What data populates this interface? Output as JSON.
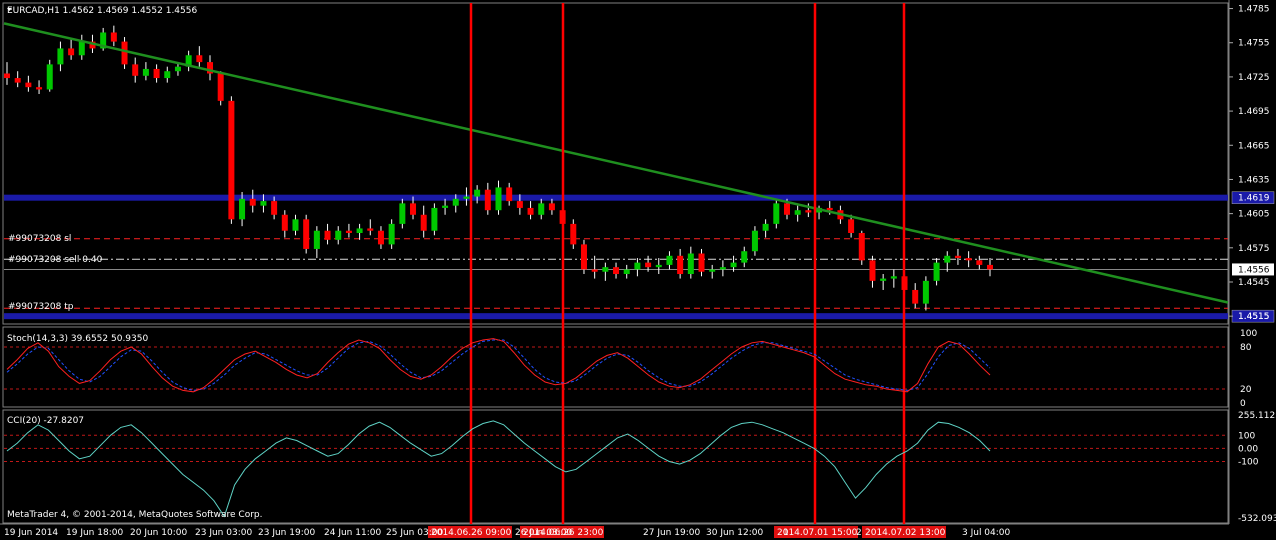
{
  "window": {
    "symbol_header": "EURCAD,H1  1.4562 1.4569 1.4552 1.4556",
    "copyright": "MetaTrader 4, © 2001-2014, MetaQuotes Software Corp."
  },
  "colors": {
    "background": "#000000",
    "bull_candle": "#00c800",
    "bear_candle": "#ff0000",
    "wick": "#ffffff",
    "trendline": "#1f8f1f",
    "support_line": "#1a1aa8",
    "vline": "#ff0000",
    "sl_line": "#ff2020",
    "tp_line": "#ff2020",
    "entry_line": "#dddddd",
    "stoch_main": "#ff2020",
    "stoch_signal": "#2050ff",
    "cci": "#5fd3c6",
    "indicator_level": "#c01818"
  },
  "main_panel": {
    "price_ticks": [
      "1.4785",
      "1.4755",
      "1.4725",
      "1.4695",
      "1.4665",
      "1.4635",
      "1.4605",
      "1.4575",
      "1.4545",
      "1.4515"
    ],
    "horizontal_level_tags": [
      {
        "name": "upper-support",
        "price": 1.4619,
        "tag": "1.4619"
      },
      {
        "name": "lower-support",
        "price": 1.4515,
        "tag": "1.4515"
      }
    ],
    "order_lines": {
      "sl_label": "#99073208 sl",
      "entry_label": "#99073208 sell 0.40",
      "tp_label": "#99073208 tp",
      "sl_price": 1.4583,
      "entry_price": 1.4565,
      "current_price": 1.4556,
      "current_price_tag": "1.4556",
      "tp_price": 1.4522
    }
  },
  "stoch_panel": {
    "label": "Stoch(14,3,3) 39.6552 50.9350",
    "ticks": [
      "100",
      "80",
      "20",
      "0"
    ],
    "levels": [
      80,
      20
    ]
  },
  "cci_panel": {
    "label": "CCI(20) -27.8207",
    "ticks": [
      "255.1125",
      "100",
      "0.00",
      "-100",
      "-532.093"
    ],
    "levels": [
      100,
      0,
      -100
    ]
  },
  "time_axis": {
    "labels": [
      "19 Jun 2014",
      "19 Jun 18:00",
      "20 Jun 10:00",
      "23 Jun 03:00",
      "23 Jun 19:00",
      "24 Jun 11:00",
      "25 Jun 03:00",
      "26 Jun 03:00",
      "27 Jun 19:00",
      "30 Jun 12:00",
      "1",
      "2",
      "3 Jul 04:00"
    ],
    "highlighted": [
      "2014.06.26 09:00",
      "2014.06.26 23:00",
      "2014.07.01 15:00",
      "2014.07.02 13:00"
    ]
  },
  "chart_data": {
    "type": "candlestick",
    "title": "EURCAD,H1",
    "ylim": [
      1.4509,
      1.4789
    ],
    "bars": [
      [
        1.4728,
        1.4738,
        1.4718,
        1.4724
      ],
      [
        1.4724,
        1.473,
        1.4716,
        1.472
      ],
      [
        1.472,
        1.4726,
        1.4712,
        1.4716
      ],
      [
        1.4716,
        1.4722,
        1.471,
        1.4714
      ],
      [
        1.4714,
        1.474,
        1.4712,
        1.4736
      ],
      [
        1.4736,
        1.4756,
        1.473,
        1.475
      ],
      [
        1.475,
        1.4758,
        1.474,
        1.4744
      ],
      [
        1.4744,
        1.4762,
        1.474,
        1.4756
      ],
      [
        1.4756,
        1.4762,
        1.4746,
        1.475
      ],
      [
        1.475,
        1.4768,
        1.4748,
        1.4764
      ],
      [
        1.4764,
        1.477,
        1.4752,
        1.4756
      ],
      [
        1.4756,
        1.476,
        1.4732,
        1.4736
      ],
      [
        1.4736,
        1.4742,
        1.472,
        1.4726
      ],
      [
        1.4726,
        1.4738,
        1.4722,
        1.4732
      ],
      [
        1.4732,
        1.4736,
        1.472,
        1.4724
      ],
      [
        1.4724,
        1.4734,
        1.472,
        1.473
      ],
      [
        1.473,
        1.4738,
        1.4726,
        1.4734
      ],
      [
        1.4734,
        1.4748,
        1.473,
        1.4744
      ],
      [
        1.4744,
        1.4752,
        1.4734,
        1.4738
      ],
      [
        1.4738,
        1.4744,
        1.4722,
        1.4728
      ],
      [
        1.4728,
        1.473,
        1.47,
        1.4704
      ],
      [
        1.4704,
        1.4708,
        1.4596,
        1.46
      ],
      [
        1.46,
        1.4624,
        1.4594,
        1.4618
      ],
      [
        1.4618,
        1.4626,
        1.4606,
        1.4612
      ],
      [
        1.4612,
        1.4622,
        1.4606,
        1.4616
      ],
      [
        1.4616,
        1.462,
        1.46,
        1.4604
      ],
      [
        1.4604,
        1.4608,
        1.4584,
        1.459
      ],
      [
        1.459,
        1.4604,
        1.4586,
        1.46
      ],
      [
        1.46,
        1.4604,
        1.457,
        1.4574
      ],
      [
        1.4574,
        1.4594,
        1.4566,
        1.459
      ],
      [
        1.459,
        1.4596,
        1.4578,
        1.4582
      ],
      [
        1.4582,
        1.4594,
        1.4578,
        1.459
      ],
      [
        1.459,
        1.4596,
        1.4584,
        1.4588
      ],
      [
        1.4588,
        1.4596,
        1.4582,
        1.4592
      ],
      [
        1.4592,
        1.46,
        1.4586,
        1.459
      ],
      [
        1.459,
        1.4594,
        1.4574,
        1.4578
      ],
      [
        1.4578,
        1.46,
        1.4574,
        1.4596
      ],
      [
        1.4596,
        1.4618,
        1.4592,
        1.4614
      ],
      [
        1.4614,
        1.462,
        1.46,
        1.4604
      ],
      [
        1.4604,
        1.4612,
        1.4584,
        1.459
      ],
      [
        1.459,
        1.4614,
        1.4586,
        1.461
      ],
      [
        1.461,
        1.4618,
        1.4604,
        1.4612
      ],
      [
        1.4612,
        1.4622,
        1.4606,
        1.4618
      ],
      [
        1.4618,
        1.4628,
        1.4612,
        1.462
      ],
      [
        1.462,
        1.463,
        1.4614,
        1.4626
      ],
      [
        1.4626,
        1.4632,
        1.4604,
        1.4608
      ],
      [
        1.4608,
        1.4634,
        1.4604,
        1.4628
      ],
      [
        1.4628,
        1.4632,
        1.4612,
        1.4616
      ],
      [
        1.4616,
        1.4622,
        1.4604,
        1.461
      ],
      [
        1.461,
        1.4616,
        1.46,
        1.4604
      ],
      [
        1.4604,
        1.4618,
        1.46,
        1.4614
      ],
      [
        1.4614,
        1.4618,
        1.4604,
        1.4608
      ],
      [
        1.4608,
        1.4612,
        1.4592,
        1.4596
      ],
      [
        1.4596,
        1.46,
        1.4574,
        1.4578
      ],
      [
        1.4578,
        1.4582,
        1.4552,
        1.4556
      ],
      [
        1.4556,
        1.4568,
        1.4548,
        1.4554
      ],
      [
        1.4554,
        1.4562,
        1.4546,
        1.4558
      ],
      [
        1.4558,
        1.4562,
        1.4548,
        1.4552
      ],
      [
        1.4552,
        1.456,
        1.4548,
        1.4556
      ],
      [
        1.4556,
        1.4566,
        1.455,
        1.4562
      ],
      [
        1.4562,
        1.4568,
        1.4554,
        1.4558
      ],
      [
        1.4558,
        1.4566,
        1.4552,
        1.456
      ],
      [
        1.456,
        1.4572,
        1.4556,
        1.4568
      ],
      [
        1.4568,
        1.4574,
        1.4548,
        1.4552
      ],
      [
        1.4552,
        1.4576,
        1.4548,
        1.457
      ],
      [
        1.457,
        1.4574,
        1.455,
        1.4554
      ],
      [
        1.4554,
        1.456,
        1.4548,
        1.4556
      ],
      [
        1.4556,
        1.4564,
        1.455,
        1.4558
      ],
      [
        1.4558,
        1.4568,
        1.4554,
        1.4562
      ],
      [
        1.4562,
        1.4576,
        1.4558,
        1.4572
      ],
      [
        1.4572,
        1.4594,
        1.4568,
        1.459
      ],
      [
        1.459,
        1.46,
        1.4584,
        1.4596
      ],
      [
        1.4596,
        1.4618,
        1.4592,
        1.4614
      ],
      [
        1.4614,
        1.4618,
        1.46,
        1.4604
      ],
      [
        1.4604,
        1.4612,
        1.4598,
        1.4608
      ],
      [
        1.4608,
        1.4614,
        1.4602,
        1.4606
      ],
      [
        1.4606,
        1.4612,
        1.46,
        1.461
      ],
      [
        1.461,
        1.4616,
        1.4604,
        1.4608
      ],
      [
        1.4608,
        1.4612,
        1.4596,
        1.46
      ],
      [
        1.46,
        1.4604,
        1.4584,
        1.4588
      ],
      [
        1.4588,
        1.459,
        1.456,
        1.4564
      ],
      [
        1.4564,
        1.4568,
        1.454,
        1.4546
      ],
      [
        1.4546,
        1.4552,
        1.4538,
        1.4548
      ],
      [
        1.4548,
        1.4556,
        1.454,
        1.455
      ],
      [
        1.455,
        1.4554,
        1.4534,
        1.4538
      ],
      [
        1.4538,
        1.4544,
        1.4522,
        1.4526
      ],
      [
        1.4526,
        1.455,
        1.452,
        1.4546
      ],
      [
        1.4546,
        1.4566,
        1.4542,
        1.4562
      ],
      [
        1.4562,
        1.4572,
        1.4554,
        1.4568
      ],
      [
        1.4568,
        1.4574,
        1.456,
        1.4566
      ],
      [
        1.4566,
        1.4572,
        1.4558,
        1.4564
      ],
      [
        1.4564,
        1.4568,
        1.4556,
        1.456
      ],
      [
        1.456,
        1.4566,
        1.455,
        1.4556
      ]
    ],
    "trendline": [
      [
        0,
        1.4772
      ],
      [
        1276,
        1.4527
      ]
    ],
    "vertical_markers": [
      "2014.06.26 09:00",
      "2014.06.26 23:00",
      "2014.07.01 15:00",
      "2014.07.02 13:00"
    ],
    "stochastic": {
      "main": [
        48,
        62,
        78,
        86,
        74,
        52,
        38,
        28,
        32,
        46,
        62,
        74,
        80,
        70,
        52,
        36,
        24,
        18,
        16,
        22,
        34,
        48,
        62,
        70,
        74,
        66,
        58,
        48,
        40,
        36,
        42,
        58,
        72,
        84,
        90,
        86,
        78,
        62,
        48,
        38,
        34,
        40,
        52,
        66,
        78,
        86,
        90,
        92,
        88,
        72,
        54,
        40,
        30,
        26,
        28,
        36,
        48,
        60,
        68,
        72,
        64,
        52,
        40,
        30,
        24,
        22,
        26,
        34,
        46,
        58,
        70,
        80,
        86,
        88,
        84,
        80,
        76,
        72,
        66,
        54,
        42,
        34,
        30,
        26,
        24,
        20,
        18,
        16,
        28,
        56,
        80,
        88,
        84,
        70,
        54,
        40
      ],
      "signal": [
        44,
        56,
        70,
        80,
        78,
        62,
        46,
        34,
        30,
        38,
        52,
        66,
        76,
        74,
        60,
        44,
        30,
        22,
        18,
        20,
        28,
        40,
        54,
        64,
        72,
        70,
        62,
        54,
        46,
        40,
        40,
        50,
        64,
        78,
        86,
        88,
        82,
        70,
        56,
        44,
        36,
        38,
        46,
        58,
        70,
        80,
        88,
        90,
        90,
        80,
        64,
        48,
        36,
        30,
        28,
        32,
        42,
        54,
        64,
        70,
        68,
        58,
        46,
        36,
        28,
        24,
        24,
        30,
        40,
        52,
        64,
        74,
        82,
        86,
        86,
        82,
        78,
        74,
        70,
        60,
        50,
        40,
        34,
        30,
        26,
        22,
        20,
        18,
        22,
        42,
        66,
        82,
        86,
        78,
        64,
        50
      ]
    },
    "cci": [
      -20,
      40,
      120,
      180,
      140,
      60,
      -20,
      -80,
      -60,
      20,
      100,
      160,
      180,
      120,
      40,
      -40,
      -120,
      -200,
      -260,
      -320,
      -400,
      -520,
      -280,
      -160,
      -80,
      -20,
      40,
      80,
      60,
      20,
      -20,
      -60,
      -40,
      30,
      110,
      170,
      200,
      160,
      100,
      40,
      -10,
      -60,
      -40,
      20,
      90,
      150,
      190,
      210,
      180,
      110,
      40,
      -20,
      -80,
      -140,
      -180,
      -160,
      -100,
      -40,
      20,
      80,
      110,
      60,
      0,
      -60,
      -100,
      -120,
      -90,
      -40,
      30,
      100,
      160,
      190,
      200,
      180,
      150,
      120,
      80,
      40,
      0,
      -60,
      -140,
      -260,
      -380,
      -300,
      -200,
      -120,
      -60,
      -20,
      40,
      140,
      200,
      190,
      160,
      120,
      60,
      -20
    ]
  }
}
